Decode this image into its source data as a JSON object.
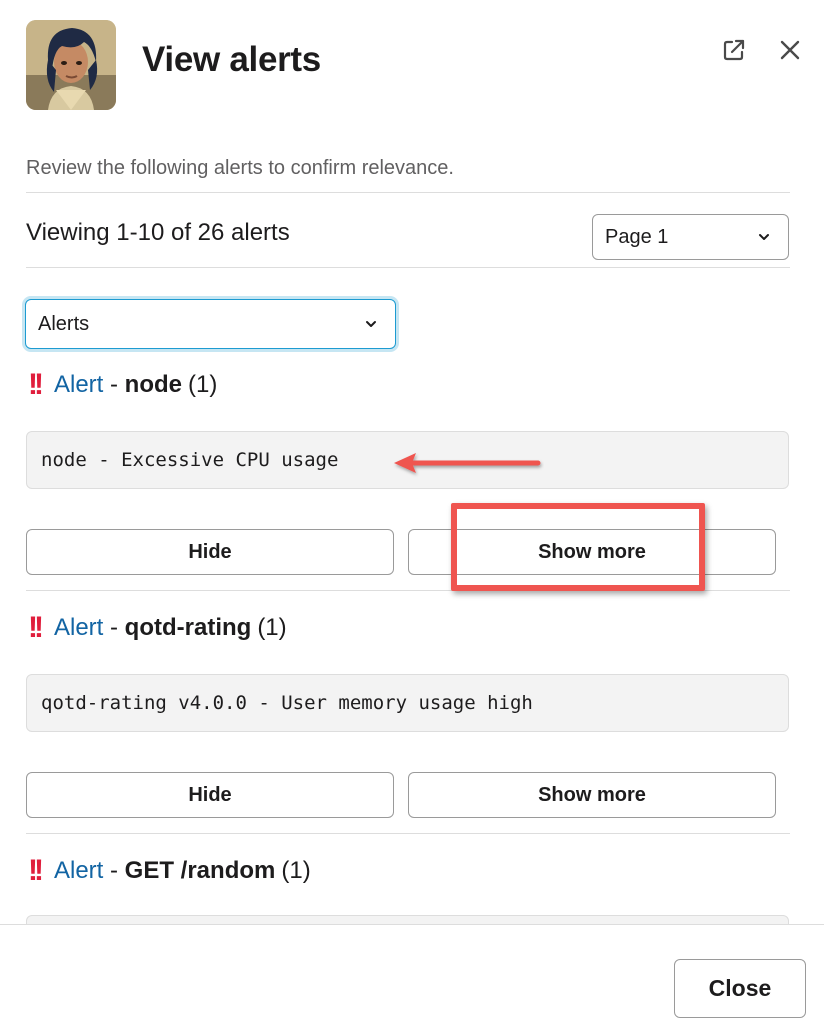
{
  "modal": {
    "title": "View alerts",
    "description": "Review the following alerts to confirm relevance.",
    "viewing_text": "Viewing 1-10 of 26 alerts",
    "page_select": "Page 1",
    "filter_select": "Alerts",
    "close_label": "Close"
  },
  "alerts": [
    {
      "link_label": "Alert",
      "separator": " - ",
      "name": "node",
      "count": "(1)",
      "message": "node - Excessive CPU usage",
      "hide_label": "Hide",
      "show_more_label": "Show more"
    },
    {
      "link_label": "Alert",
      "separator": " - ",
      "name": "qotd-rating",
      "count": "(1)",
      "message": "qotd-rating v4.0.0 - User memory usage high",
      "hide_label": "Hide",
      "show_more_label": "Show more"
    },
    {
      "link_label": "Alert",
      "separator": " - ",
      "name": "GET /random",
      "count": "(1)"
    }
  ],
  "icons": {
    "popout": "external-link-icon",
    "close": "close-icon",
    "chevron": "chevron-down-icon",
    "alert": "double-exclamation-icon"
  },
  "colors": {
    "link": "#1264a3",
    "alert_red": "#e01e3c",
    "annotation_red": "#ef5550",
    "focus_blue": "#1d9bd1"
  }
}
